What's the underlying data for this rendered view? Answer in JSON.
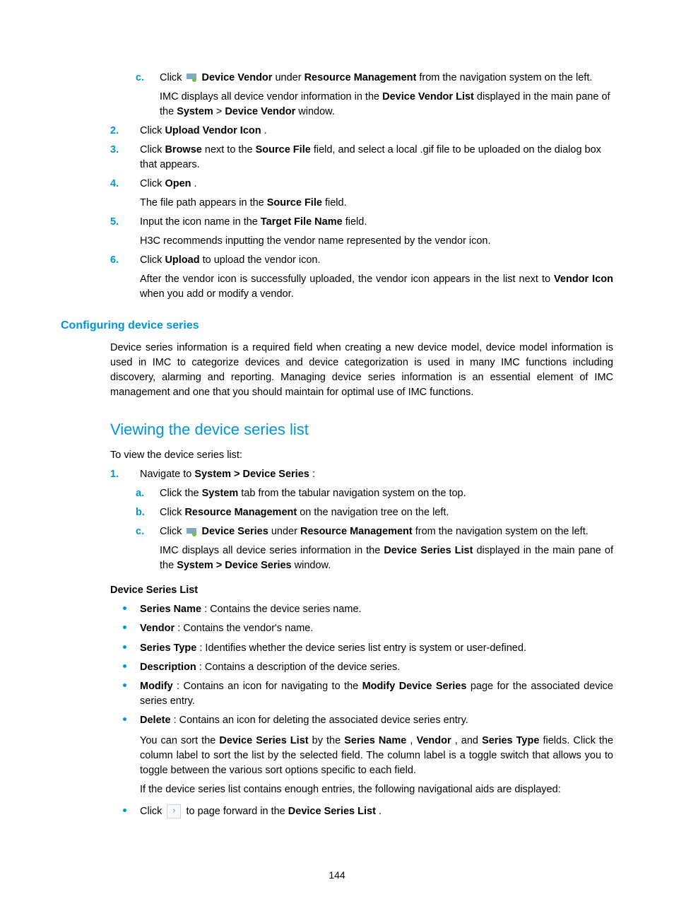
{
  "letters": {
    "c1": "c.",
    "a2": "a.",
    "b2": "b.",
    "c2": "c."
  },
  "nums": {
    "n2": "2.",
    "n3": "3.",
    "n4": "4.",
    "n5": "5.",
    "n6": "6.",
    "s1": "1."
  },
  "icons": {
    "vendor": "device-vendor-icon",
    "series": "device-series-icon",
    "pageNext": "›"
  },
  "top": {
    "c_pre": "Click ",
    "c_bold1": "Device Vendor",
    "c_mid": " under ",
    "c_bold2": "Resource Management",
    "c_post": " from the navigation system on the left.",
    "c_follow_pre": "IMC displays all device vendor information in the ",
    "c_follow_bold1": "Device Vendor List",
    "c_follow_mid": " displayed in the main pane of the ",
    "c_follow_bold2": "System",
    "c_follow_gt": " > ",
    "c_follow_bold3": "Device Vendor",
    "c_follow_post": " window."
  },
  "step2": {
    "pre": "Click ",
    "bold": "Upload Vendor Icon",
    "post": "."
  },
  "step3": {
    "pre": "Click ",
    "bold1": "Browse",
    "mid": " next to the ",
    "bold2": "Source File",
    "post": " field, and select a local .gif file to be uploaded on the dialog box that appears."
  },
  "step4": {
    "pre": "Click ",
    "bold": "Open",
    "post": ".",
    "follow_pre": "The file path appears in the ",
    "follow_bold": "Source File",
    "follow_post": " field."
  },
  "step5": {
    "pre": "Input the icon name in the ",
    "bold": "Target File Name",
    "post": " field.",
    "follow": "H3C recommends inputting the vendor name represented by the vendor icon."
  },
  "step6": {
    "pre": "Click ",
    "bold": "Upload",
    "post": " to upload the vendor icon.",
    "follow_pre": "After the vendor icon is successfully uploaded, the vendor icon appears in the list next to ",
    "follow_bold": "Vendor Icon",
    "follow_post": " when you add or modify a vendor."
  },
  "h_config": "Configuring device series",
  "config_para": "Device series information is a required field when creating a new device model, device model information is used in IMC to categorize devices and device categorization is used in many IMC functions including discovery, alarming and reporting. Managing device series information is an essential element of IMC management and one that you should maintain for optimal use of IMC functions.",
  "h_view": "Viewing the device series list",
  "view_intro": "To view the device series list:",
  "view1": {
    "pre": "Navigate to ",
    "bold": "System > Device Series",
    "post": ":"
  },
  "view_a": {
    "pre": "Click the ",
    "bold": "System",
    "post": " tab from the tabular navigation system on the top."
  },
  "view_b": {
    "pre": "Click ",
    "bold": "Resource Management",
    "post": " on the navigation tree on the left."
  },
  "view_c": {
    "pre": "Click ",
    "bold1": "Device Series",
    "mid": " under ",
    "bold2": "Resource Management",
    "post": " from the navigation system on the left.",
    "follow_pre": "IMC displays all device series information in the ",
    "follow_bold1": "Device Series List",
    "follow_mid": " displayed in the main pane of the ",
    "follow_bold2": "System > Device Series",
    "follow_post": " window."
  },
  "dsl_head": "Device Series List",
  "bul": {
    "b1_bold": "Series Name",
    "b1_post": ": Contains the device series name.",
    "b2_bold": "Vendor",
    "b2_post": ": Contains the vendor's name.",
    "b3_bold": "Series Type",
    "b3_post": ": Identifies whether the device series list entry is system or user-defined.",
    "b4_bold": "Description",
    "b4_post": ": Contains a description of the device series.",
    "b5_bold": "Modify",
    "b5_mid": ": Contains an icon for navigating to the ",
    "b5_bold2": "Modify Device Series",
    "b5_post": " page for the associated device series entry.",
    "b6_bold": "Delete",
    "b6_post": ": Contains an icon for deleting the associated device series entry."
  },
  "sort_p1_pre": "You can sort the ",
  "sort_p1_b1": "Device Series List",
  "sort_p1_mid1": " by the ",
  "sort_p1_b2": "Series Name",
  "sort_p1_comma1": ", ",
  "sort_p1_b3": "Vendor",
  "sort_p1_comma2": ", and ",
  "sort_p1_b4": "Series Type",
  "sort_p1_post": " fields. Click the column label to sort the list by the selected field. The column label is a toggle switch that allows you to toggle between the various sort options specific to each field.",
  "nav_hint": "If the device series list contains enough entries, the following navigational aids are displayed:",
  "page_fwd_pre": "Click ",
  "page_fwd_mid": " to page forward in the ",
  "page_fwd_bold": "Device Series List",
  "page_fwd_post": ".",
  "pagenum": "144"
}
